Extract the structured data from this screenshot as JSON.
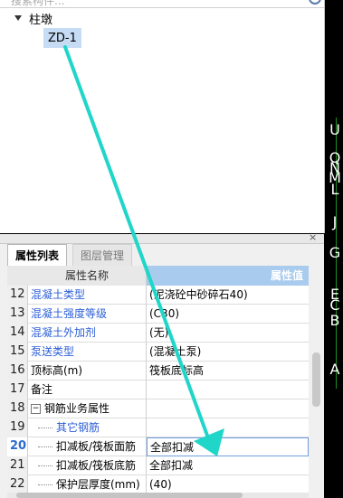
{
  "search": {
    "placeholder": "搜索构件..."
  },
  "tree": {
    "root_label": "柱墩",
    "child_label": "ZD-1"
  },
  "tabs": [
    {
      "label": "属性列表"
    },
    {
      "label": "图层管理"
    }
  ],
  "grid": {
    "header_name": "属性名称",
    "header_value": "属性值",
    "rows": [
      {
        "num": "12",
        "name": "混凝土类型",
        "value": "(泥浇砼中砂碎石40)"
      },
      {
        "num": "13",
        "name": "混凝土强度等级",
        "value": "(C30)"
      },
      {
        "num": "14",
        "name": "混凝土外加剂",
        "value": "(无)"
      },
      {
        "num": "15",
        "name": "泵送类型",
        "value": "(混凝土泵)"
      },
      {
        "num": "16",
        "name": "顶标高(m)",
        "value": "筏板底标高"
      },
      {
        "num": "17",
        "name": "备注",
        "value": ""
      },
      {
        "num": "18",
        "name": "钢筋业务属性",
        "value": ""
      },
      {
        "num": "19",
        "name": "其它钢筋",
        "value": ""
      },
      {
        "num": "20",
        "name": "扣减板/筏板面筋",
        "value": "全部扣减"
      },
      {
        "num": "21",
        "name": "扣减板/筏板底筋",
        "value": "全部扣减"
      },
      {
        "num": "22",
        "name": "保护层厚度(mm)",
        "value": "(40)"
      }
    ]
  },
  "axis_labels": [
    "U",
    "Q",
    "N",
    "M",
    "L",
    "J",
    "G",
    "E",
    "C",
    "B",
    "A"
  ],
  "close_symbol": "×",
  "expander_symbol": "−",
  "colors": {
    "arrow": "#1fd6c8",
    "axis": "#1f8f1f",
    "selection": "#c6dcf5",
    "link_text": "#2c5fd6"
  }
}
